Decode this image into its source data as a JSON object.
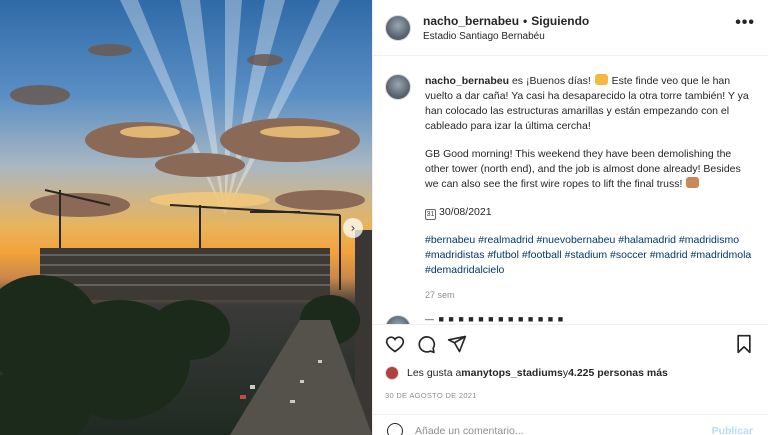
{
  "post": {
    "username": "nacho_bernabeu",
    "dot": "•",
    "follow_label": "Siguiendo",
    "location": "Estadio Santiago Bernabéu",
    "more_label": "•••",
    "photo_next_label": "›"
  },
  "caption": {
    "username": "nacho_bernabeu",
    "spanish_1": " es ¡Buenos días! ",
    "spanish_2": " Este finde veo que le han vuelto a dar caña! Ya casi ha desaparecido la otra torre también! Y ya han colocado las estructuras amarillas y están empezando con el cableado para izar la última cercha!",
    "english_1": "GB Good morning! This weekend they have been demolishing the other tower (north end), and the job is almost done already! Besides we can also see the first wire ropes to lift the final truss! ",
    "date_icon": "31",
    "date_line": "30/08/2021",
    "hashtags": "#bernabeu #realmadrid #nuevobernabeu #halamadrid #madridismo #madridistas #futbol #football #stadium #soccer #madrid #madridmola #demadridalcielo",
    "time_ago": "27 sem",
    "next_comment_peek": "— ■ ■ ■ ■ ■ ■ ■ ■ ■ ■ ■ ■ ■"
  },
  "likes": {
    "prefix": "Les gusta a ",
    "user": "manytops_stadiums",
    "middle": " y ",
    "count": "4.225 personas más"
  },
  "date_text": "30 DE AGOSTO DE 2021",
  "comment_box": {
    "placeholder": "Añade un comentario...",
    "post_label": "Publicar"
  },
  "colors": {
    "link": "#00376b",
    "muted": "#8e8e8e",
    "post_disabled": "#b2dffc"
  }
}
